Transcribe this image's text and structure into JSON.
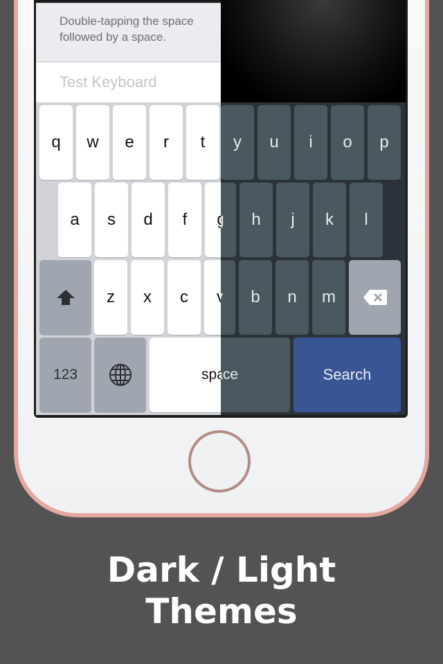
{
  "screen": {
    "note_text": "Double-tapping the space\nfollowed by a space.",
    "test_field_placeholder": "Test Keyboard"
  },
  "keyboard": {
    "row1": [
      "q",
      "w",
      "e",
      "r",
      "t",
      "y",
      "u",
      "i",
      "o",
      "p"
    ],
    "row2": [
      "a",
      "s",
      "d",
      "f",
      "g",
      "h",
      "j",
      "k",
      "l"
    ],
    "row3": [
      "z",
      "x",
      "c",
      "v",
      "b",
      "n",
      "m"
    ],
    "numbers_label": "123",
    "space_label": "space",
    "search_label": "Search",
    "shift_icon": "shift-arrow-icon",
    "delete_icon": "backspace-icon",
    "globe_icon": "globe-icon",
    "accent_color": "#3a5594"
  },
  "themes": [
    "Light",
    "Dark"
  ],
  "caption": {
    "line1": "Dark / Light",
    "line2": "Themes"
  }
}
